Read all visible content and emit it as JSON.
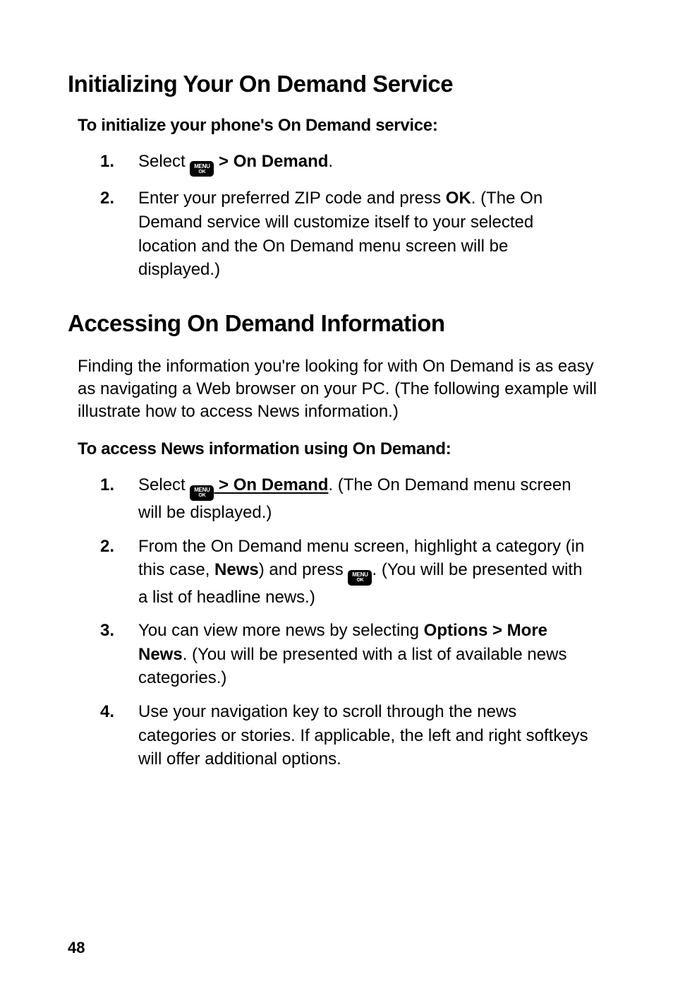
{
  "section1": {
    "heading": "Initializing Your On Demand Service",
    "subhead": "To initialize your phone's On Demand service:",
    "steps": [
      {
        "pre": "Select ",
        "post": " > On Demand",
        "tail": "."
      },
      {
        "pre": "Enter your preferred ZIP code and press ",
        "bold1": "OK",
        "tail": ". (The On Demand service will customize itself to your selected location and the On Demand menu screen will be displayed.)"
      }
    ]
  },
  "section2": {
    "heading": "Accessing On Demand Information",
    "body": "Finding the information you're looking for with On Demand is as easy as navigating a Web browser on your PC. (The following example will illustrate how to access News information.)",
    "subhead": "To access News information using On Demand:",
    "steps": [
      {
        "pre": "Select ",
        "post": " > On Demand",
        "tail": ". (The On Demand menu screen will be displayed.)"
      },
      {
        "pre": "From the On Demand menu screen, highlight a category (in this case, ",
        "bold1": "News",
        "mid": ") and press ",
        "tail": ". (You will be presented with a list of headline news.)"
      },
      {
        "pre": "You can view more news by selecting ",
        "bold1": "Options > More News",
        "tail": ". (You will be presented with a list of available news categories.)"
      },
      {
        "pre": "Use your navigation key to scroll through the news categories or stories. If applicable, the left and right softkeys will offer additional options."
      }
    ]
  },
  "icon": {
    "line1": "MENU",
    "line2": "OK"
  },
  "pageNumber": "48"
}
